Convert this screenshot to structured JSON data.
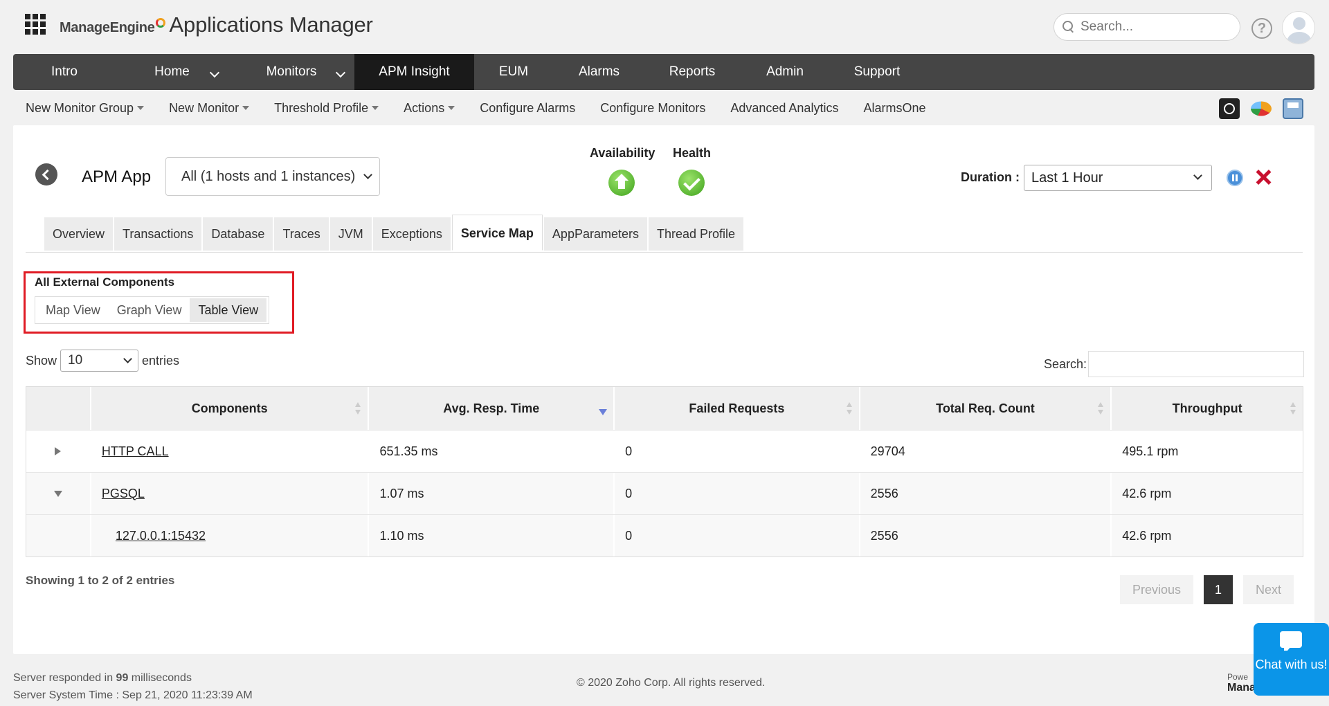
{
  "header": {
    "brand_company": "ManageEngine",
    "brand_product": "Applications Manager",
    "search_placeholder": "Search...",
    "help": "?"
  },
  "mainnav": {
    "items": [
      {
        "label": "Intro"
      },
      {
        "label": "Home",
        "caret": true
      },
      {
        "label": "Monitors",
        "caret": true
      },
      {
        "label": "APM Insight",
        "active": true
      },
      {
        "label": "EUM"
      },
      {
        "label": "Alarms"
      },
      {
        "label": "Reports"
      },
      {
        "label": "Admin"
      },
      {
        "label": "Support"
      }
    ]
  },
  "subnav": {
    "items": [
      {
        "label": "New Monitor Group",
        "caret": true
      },
      {
        "label": "New Monitor",
        "caret": true
      },
      {
        "label": "Threshold Profile",
        "caret": true
      },
      {
        "label": "Actions",
        "caret": true
      },
      {
        "label": "Configure Alarms"
      },
      {
        "label": "Configure Monitors"
      },
      {
        "label": "Advanced Analytics"
      },
      {
        "label": "AlarmsOne"
      }
    ],
    "tool_icons": [
      "camera-icon",
      "pie-chart-icon",
      "print-icon"
    ]
  },
  "app": {
    "title": "APM App",
    "instance_selected": "All (1 hosts and 1 instances)",
    "availability_label": "Availability",
    "health_label": "Health",
    "availability_status": "up",
    "health_status": "clear",
    "duration_label": "Duration :",
    "duration_selected": "Last 1 Hour"
  },
  "tabs": [
    {
      "label": "Overview"
    },
    {
      "label": "Transactions"
    },
    {
      "label": "Database"
    },
    {
      "label": "Traces"
    },
    {
      "label": "JVM"
    },
    {
      "label": "Exceptions"
    },
    {
      "label": "Service Map",
      "active": true
    },
    {
      "label": "AppParameters"
    },
    {
      "label": "Thread Profile"
    }
  ],
  "view": {
    "title": "All External Components",
    "tabs": [
      {
        "label": "Map View"
      },
      {
        "label": "Graph View"
      },
      {
        "label": "Table View",
        "active": true
      }
    ]
  },
  "datatable": {
    "show_label": "Show",
    "show_value": "10",
    "entries_label": "entries",
    "search_label": "Search:",
    "columns": [
      "Components",
      "Avg. Resp. Time",
      "Failed Requests",
      "Total Req. Count",
      "Throughput"
    ],
    "sorted_column": "Avg. Resp. Time",
    "sort_direction": "desc",
    "rows": [
      {
        "component": "HTTP CALL",
        "avg_resp": "651.35 ms",
        "failed": "0",
        "total": "29704",
        "throughput": "495.1 rpm",
        "expanded": false
      },
      {
        "component": "PGSQL",
        "avg_resp": "1.07 ms",
        "failed": "0",
        "total": "2556",
        "throughput": "42.6 rpm",
        "expanded": true
      },
      {
        "component": "127.0.0.1:15432",
        "avg_resp": "1.10 ms",
        "failed": "0",
        "total": "2556",
        "throughput": "42.6 rpm",
        "child": true
      }
    ],
    "info": "Showing 1 to 2 of 2 entries",
    "pager": {
      "previous": "Previous",
      "current": "1",
      "next": "Next"
    }
  },
  "footer": {
    "response_prefix": "Server responded in",
    "response_ms": "99",
    "response_suffix": "milliseconds",
    "server_time": "Server System Time : Sep 21, 2020 11:23:39 AM",
    "copyright": "© 2020 Zoho Corp.   All rights reserved.",
    "powered_label": "Powe",
    "powered_brand": "Mana",
    "chat_label": "Chat with us!"
  },
  "colors": {
    "nav_bg": "#454545",
    "nav_active": "#1a1a1a",
    "highlight_border": "#e01b24",
    "status_green": "#3fa21c",
    "chat_blue": "#0b95e8"
  }
}
